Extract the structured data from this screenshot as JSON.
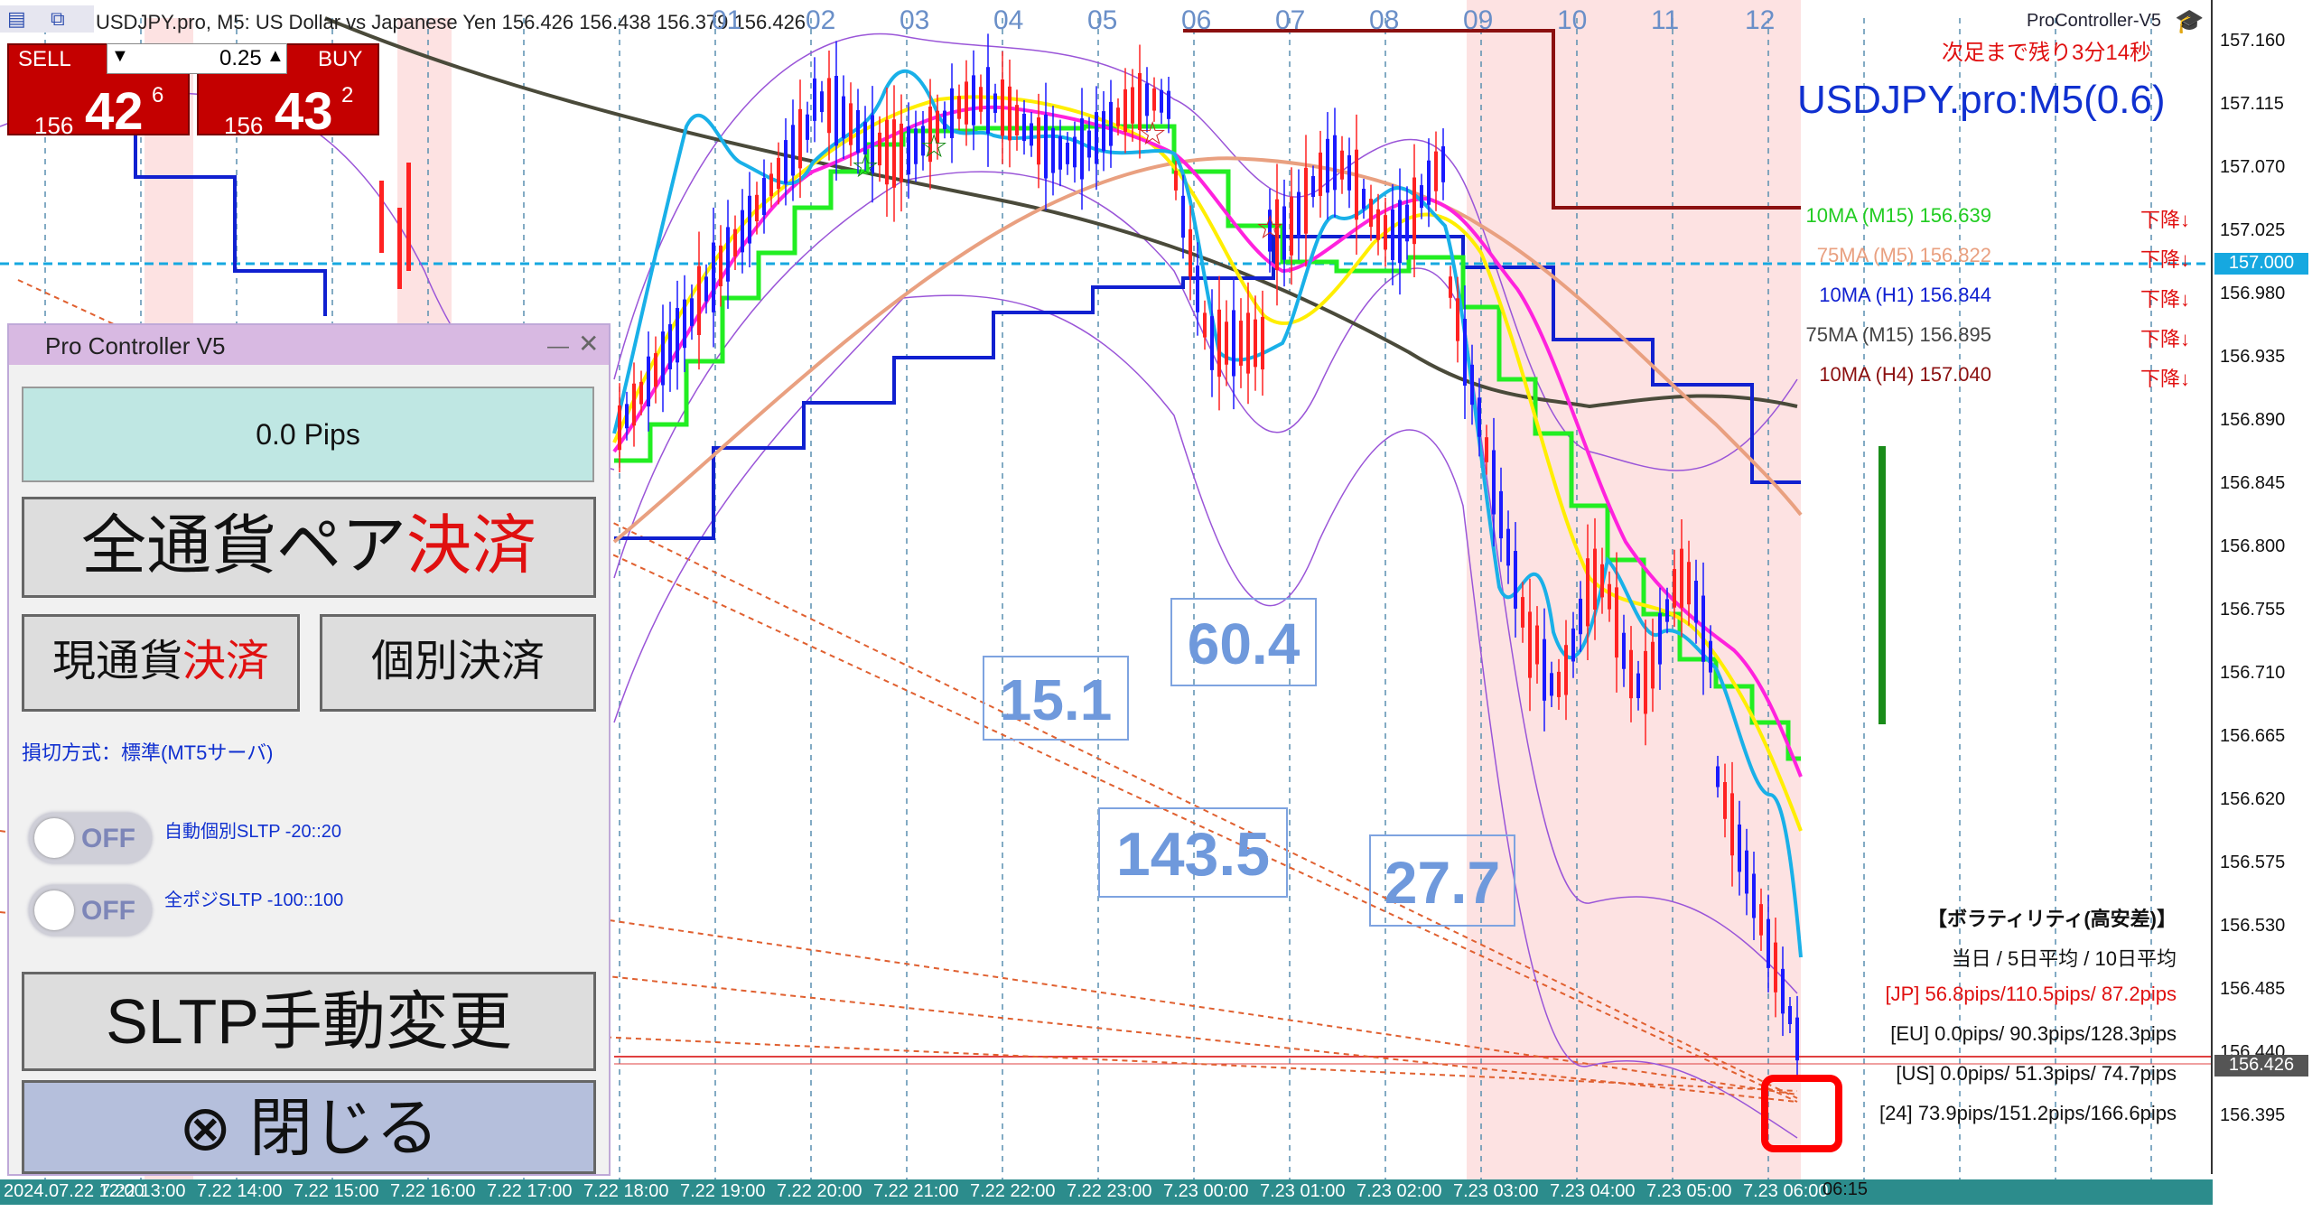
{
  "window": {
    "symbol_header": "USDJPY.pro, M5: US Dollar vs Japanese Yen  156.426 156.438 156.379 156.426",
    "brand": "ProController-V5",
    "countdown": "次足まで残り3分14秒",
    "title": "USDJPY.pro:M5(0.6)"
  },
  "trade": {
    "sell_label": "SELL",
    "buy_label": "BUY",
    "lot_value": "0.25",
    "sell_small": "156",
    "sell_big": "42",
    "sell_sup": "6",
    "buy_small": "156",
    "buy_big": "43",
    "buy_sup": "2"
  },
  "panel": {
    "title": "Pro Controller V5",
    "pips": "0.0 Pips",
    "close_all_a": "全通貨ペア",
    "close_all_b": "決済",
    "close_cur_a": "現通貨",
    "close_cur_b": "決済",
    "close_each": "個別決済",
    "sl_method": "損切方式：標準(MT5サーバ)",
    "toggle1_state": "OFF",
    "toggle1_label": "自動個別SLTP -20::20",
    "toggle2_state": "OFF",
    "toggle2_label": "全ポジSLTP -100::100",
    "manual_sltp": "SLTP手動変更",
    "close_panel": "⊗ 閉じる"
  },
  "ma_list": [
    {
      "label": "10MA (M15) 156.639",
      "trend": "下降↓",
      "color": "#22cc22"
    },
    {
      "label": "75MA (M5) 156.822",
      "trend": "下降↓",
      "color": "#e9a080"
    },
    {
      "label": "10MA (H1) 156.844",
      "trend": "下降↓",
      "color": "#1020d0"
    },
    {
      "label": "75MA (M15) 156.895",
      "trend": "下降↓",
      "color": "#444444"
    },
    {
      "label": "10MA (H4) 157.040",
      "trend": "下降↓",
      "color": "#8b1010"
    }
  ],
  "volatility": {
    "title": "【ボラティリティ(高安差)】",
    "subtitle": "当日 / 5日平均 / 10日平均",
    "rows": [
      {
        "text": "[JP] 56.8pips/110.5pips/ 87.2pips",
        "color": "#e01010"
      },
      {
        "text": "[EU]  0.0pips/ 90.3pips/128.3pips",
        "color": "#111111"
      },
      {
        "text": "[US]  0.0pips/ 51.3pips/ 74.7pips",
        "color": "#111111"
      },
      {
        "text": "[24] 73.9pips/151.2pips/166.6pips",
        "color": "#111111"
      }
    ]
  },
  "boxes": [
    {
      "text": "15.1"
    },
    {
      "text": "60.4"
    },
    {
      "text": "143.5"
    },
    {
      "text": "27.7"
    }
  ],
  "price_axis": [
    "157.160",
    "157.115",
    "157.070",
    "157.025",
    "156.980",
    "156.935",
    "156.890",
    "156.845",
    "156.800",
    "156.755",
    "156.710",
    "156.665",
    "156.620",
    "156.575",
    "156.530",
    "156.485",
    "156.440",
    "156.395"
  ],
  "price_marker_1": "157.000",
  "price_marker_2": "156.426",
  "time_axis": [
    "2024.07.22 12:00",
    "7.22 13:00",
    "7.22 14:00",
    "7.22 15:00",
    "7.22 16:00",
    "7.22 17:00",
    "7.22 18:00",
    "7.22 19:00",
    "7.22 20:00",
    "7.22 21:00",
    "7.22 22:00",
    "7.22 23:00",
    "7.23 00:00",
    "7.23 01:00",
    "7.23 02:00",
    "7.23 03:00",
    "7.23 04:00",
    "7.23 05:00",
    "7.23 06:00"
  ],
  "time_suffix": "06:15",
  "hour_labels": [
    "01",
    "02",
    "03",
    "04",
    "05",
    "06",
    "07",
    "08",
    "09",
    "10",
    "11",
    "12"
  ],
  "colors": {
    "accent_red": "#e01010",
    "session_band": "#fde2e2",
    "title_blue": "#1030d0"
  }
}
